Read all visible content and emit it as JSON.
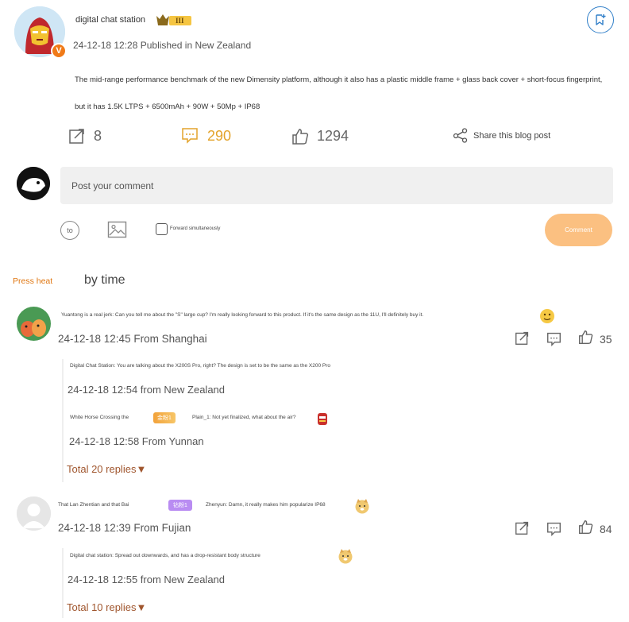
{
  "post": {
    "author": "digital chat station",
    "level_badge": "III",
    "meta": "24-12-18 12:28 Published in New Zealand",
    "text": "The mid-range performance benchmark of the new Dimensity platform, although it also has a plastic middle frame + glass back cover + short-focus fingerprint, but it has 1.5K LTPS + 6500mAh + 90W + 50Mp + IP68",
    "verified_mark": "V"
  },
  "actions": {
    "forward_count": "8",
    "comment_count": "290",
    "like_count": "1294",
    "share_label": "Share this blog post"
  },
  "composer": {
    "placeholder": "Post your comment",
    "emoji_label": "to",
    "forward_label": "Forward simultaneously",
    "submit_label": "Comment"
  },
  "sort": {
    "heat": "Press heat",
    "time": "by time"
  },
  "comments": [
    {
      "text": "Yuantong is a real jerk: Can you tell me about the \"S\" large cup? I'm really looking forward to this product. If it's the same design as the 11U, I'll definitely buy it.",
      "meta": "24-12-18 12:45 From Shanghai",
      "likes": "35",
      "replies": [
        {
          "text": "Digital Chat Station: You are talking about the X200S Pro, right? The design is set to be the same as the X200 Pro",
          "meta": "24-12-18 12:54 from New Zealand"
        },
        {
          "name": "White Horse Crossing the",
          "badge": "金粉1",
          "text": "Plain_1: Not yet finalized, what about the air?",
          "meta": "24-12-18 12:58 From Yunnan"
        }
      ],
      "total_replies": "Total 20 replies▼"
    },
    {
      "name": "That Lan Zhentian and that Bai",
      "badge": "钻粉1",
      "text": "Zhenyun: Damn, it really makes him popularize IP68",
      "meta": "24-12-18 12:39 From Fujian",
      "likes": "84",
      "replies": [
        {
          "text": "Digital chat station: Spread out downwards, and has a drop-resistant body structure",
          "meta": "24-12-18 12:55 from New Zealand"
        }
      ],
      "total_replies": "Total 10 replies▼"
    }
  ],
  "colors": {
    "accent_orange": "#e07712",
    "comment_orange": "#e3a32b",
    "bookmark_blue": "#2f7ec8",
    "button_peach": "#fbc081",
    "reply_brown": "#a0562e"
  }
}
